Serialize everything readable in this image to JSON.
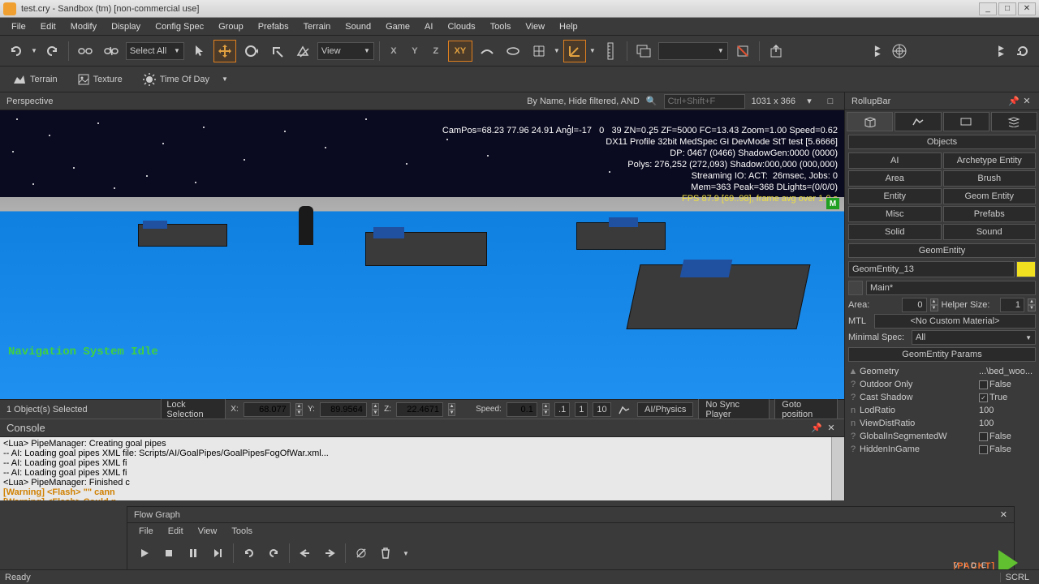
{
  "titlebar": {
    "text": "test.cry - Sandbox (tm) [non-commercial use]"
  },
  "menubar": [
    "File",
    "Edit",
    "Modify",
    "Display",
    "Config Spec",
    "Group",
    "Prefabs",
    "Terrain",
    "Sound",
    "Game",
    "AI",
    "Clouds",
    "Tools",
    "View",
    "Help"
  ],
  "toolbar": {
    "select_combo": "Select All",
    "view_combo": "View",
    "xy_label": "XY"
  },
  "toolbar2": {
    "terrain": "Terrain",
    "texture": "Texture",
    "tod": "Time Of Day"
  },
  "vp_header": {
    "perspective": "Perspective",
    "filter": "By Name, Hide filtered, AND",
    "search_placeholder": "Ctrl+Shift+F",
    "dims": "1031 x 366"
  },
  "viewport": {
    "debug": [
      "CamPos=68.23 77.96 24.91 Angl=-17   0   39 ZN=0.25 ZF=5000 FC=13.43 Zoom=1.00 Speed=0.62",
      "DX11 Profile 32bit MedSpec GI DevMode StT test [5.6666]",
      "DP: 0467 (0466) ShadowGen:0000 (0000)",
      "Polys: 276,252 (272,093) Shadow:000,000 (000,000)",
      "Streaming IO: ACT:  26msec, Jobs: 0",
      "Mem=363 Peak=368 DLights=(0/0/0)"
    ],
    "fps": "FPS 87.9 [69..98], frame avg over 1.0 s",
    "nav_idle": "Navigation System Idle"
  },
  "vp_status": {
    "selection": "1 Object(s) Selected",
    "lock": "Lock Selection",
    "x": "68.077",
    "y": "89.9564",
    "z": "22.4671",
    "speed_label": "Speed:",
    "speed": "0.1",
    "steps": [
      ".1",
      "1",
      "10"
    ],
    "ai": "AI/Physics",
    "nosync": "No Sync Player",
    "goto": "Goto position"
  },
  "console": {
    "title": "Console",
    "lines": [
      "<Lua> PipeManager: Creating goal pipes",
      "-- AI: Loading goal pipes XML file: Scripts/AI/GoalPipes/GoalPipesFogOfWar.xml...",
      "-- AI: Loading goal pipes XML fi",
      "-- AI: Loading goal pipes XML fi",
      "<Lua> PipeManager: Finished c",
      "[Warning] <Flash> \"\" cann",
      "[Warning] <Flash> Could n"
    ]
  },
  "flowgraph": {
    "title": "Flow Graph",
    "menu": [
      "File",
      "Edit",
      "View",
      "Tools"
    ]
  },
  "rollup": {
    "title": "RollupBar",
    "objects_header": "Objects",
    "obj_buttons": [
      "AI",
      "Archetype Entity",
      "Area",
      "Brush",
      "Entity",
      "Geom Entity",
      "Misc",
      "Prefabs",
      "Solid",
      "Sound"
    ],
    "geom_header": "GeomEntity",
    "entity_name": "GeomEntity_13",
    "layer": "Main*",
    "area_label": "Area:",
    "area_val": "0",
    "helper_label": "Helper Size:",
    "helper_val": "1",
    "mtl_label": "MTL",
    "mtl_val": "<No Custom Material>",
    "minspec_label": "Minimal Spec:",
    "minspec_val": "All",
    "params_header": "GeomEntity Params",
    "params": [
      {
        "icon": "▲",
        "name": "Geometry",
        "val": "...\\bed_woo..."
      },
      {
        "icon": "?",
        "name": "Outdoor Only",
        "val": "False",
        "chk": false
      },
      {
        "icon": "?",
        "name": "Cast Shadow",
        "val": "True",
        "chk": true
      },
      {
        "icon": "n",
        "name": "LodRatio",
        "val": "100"
      },
      {
        "icon": "n",
        "name": "ViewDistRatio",
        "val": "100"
      },
      {
        "icon": "?",
        "name": "GlobalInSegmentedW",
        "val": "False",
        "chk": false
      },
      {
        "icon": "?",
        "name": "HiddenInGame",
        "val": "False",
        "chk": false
      }
    ]
  },
  "bottom": {
    "ready": "Ready",
    "scrl": "SCRL"
  },
  "packt": {
    "text": "PACKT",
    "sub": "V I D E O"
  }
}
